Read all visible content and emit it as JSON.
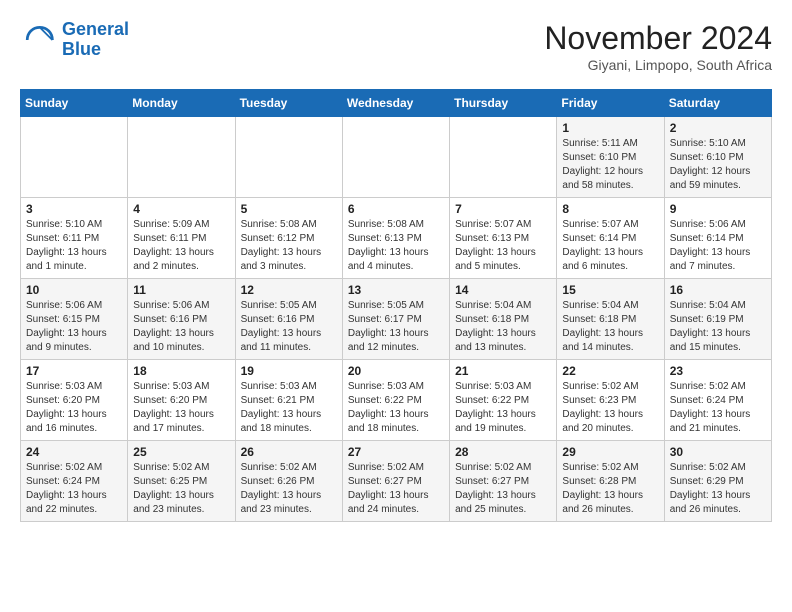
{
  "header": {
    "logo_line1": "General",
    "logo_line2": "Blue",
    "month": "November 2024",
    "location": "Giyani, Limpopo, South Africa"
  },
  "days_of_week": [
    "Sunday",
    "Monday",
    "Tuesday",
    "Wednesday",
    "Thursday",
    "Friday",
    "Saturday"
  ],
  "weeks": [
    [
      {
        "day": "",
        "info": ""
      },
      {
        "day": "",
        "info": ""
      },
      {
        "day": "",
        "info": ""
      },
      {
        "day": "",
        "info": ""
      },
      {
        "day": "",
        "info": ""
      },
      {
        "day": "1",
        "info": "Sunrise: 5:11 AM\nSunset: 6:10 PM\nDaylight: 12 hours and 58 minutes."
      },
      {
        "day": "2",
        "info": "Sunrise: 5:10 AM\nSunset: 6:10 PM\nDaylight: 12 hours and 59 minutes."
      }
    ],
    [
      {
        "day": "3",
        "info": "Sunrise: 5:10 AM\nSunset: 6:11 PM\nDaylight: 13 hours and 1 minute."
      },
      {
        "day": "4",
        "info": "Sunrise: 5:09 AM\nSunset: 6:11 PM\nDaylight: 13 hours and 2 minutes."
      },
      {
        "day": "5",
        "info": "Sunrise: 5:08 AM\nSunset: 6:12 PM\nDaylight: 13 hours and 3 minutes."
      },
      {
        "day": "6",
        "info": "Sunrise: 5:08 AM\nSunset: 6:13 PM\nDaylight: 13 hours and 4 minutes."
      },
      {
        "day": "7",
        "info": "Sunrise: 5:07 AM\nSunset: 6:13 PM\nDaylight: 13 hours and 5 minutes."
      },
      {
        "day": "8",
        "info": "Sunrise: 5:07 AM\nSunset: 6:14 PM\nDaylight: 13 hours and 6 minutes."
      },
      {
        "day": "9",
        "info": "Sunrise: 5:06 AM\nSunset: 6:14 PM\nDaylight: 13 hours and 7 minutes."
      }
    ],
    [
      {
        "day": "10",
        "info": "Sunrise: 5:06 AM\nSunset: 6:15 PM\nDaylight: 13 hours and 9 minutes."
      },
      {
        "day": "11",
        "info": "Sunrise: 5:06 AM\nSunset: 6:16 PM\nDaylight: 13 hours and 10 minutes."
      },
      {
        "day": "12",
        "info": "Sunrise: 5:05 AM\nSunset: 6:16 PM\nDaylight: 13 hours and 11 minutes."
      },
      {
        "day": "13",
        "info": "Sunrise: 5:05 AM\nSunset: 6:17 PM\nDaylight: 13 hours and 12 minutes."
      },
      {
        "day": "14",
        "info": "Sunrise: 5:04 AM\nSunset: 6:18 PM\nDaylight: 13 hours and 13 minutes."
      },
      {
        "day": "15",
        "info": "Sunrise: 5:04 AM\nSunset: 6:18 PM\nDaylight: 13 hours and 14 minutes."
      },
      {
        "day": "16",
        "info": "Sunrise: 5:04 AM\nSunset: 6:19 PM\nDaylight: 13 hours and 15 minutes."
      }
    ],
    [
      {
        "day": "17",
        "info": "Sunrise: 5:03 AM\nSunset: 6:20 PM\nDaylight: 13 hours and 16 minutes."
      },
      {
        "day": "18",
        "info": "Sunrise: 5:03 AM\nSunset: 6:20 PM\nDaylight: 13 hours and 17 minutes."
      },
      {
        "day": "19",
        "info": "Sunrise: 5:03 AM\nSunset: 6:21 PM\nDaylight: 13 hours and 18 minutes."
      },
      {
        "day": "20",
        "info": "Sunrise: 5:03 AM\nSunset: 6:22 PM\nDaylight: 13 hours and 18 minutes."
      },
      {
        "day": "21",
        "info": "Sunrise: 5:03 AM\nSunset: 6:22 PM\nDaylight: 13 hours and 19 minutes."
      },
      {
        "day": "22",
        "info": "Sunrise: 5:02 AM\nSunset: 6:23 PM\nDaylight: 13 hours and 20 minutes."
      },
      {
        "day": "23",
        "info": "Sunrise: 5:02 AM\nSunset: 6:24 PM\nDaylight: 13 hours and 21 minutes."
      }
    ],
    [
      {
        "day": "24",
        "info": "Sunrise: 5:02 AM\nSunset: 6:24 PM\nDaylight: 13 hours and 22 minutes."
      },
      {
        "day": "25",
        "info": "Sunrise: 5:02 AM\nSunset: 6:25 PM\nDaylight: 13 hours and 23 minutes."
      },
      {
        "day": "26",
        "info": "Sunrise: 5:02 AM\nSunset: 6:26 PM\nDaylight: 13 hours and 23 minutes."
      },
      {
        "day": "27",
        "info": "Sunrise: 5:02 AM\nSunset: 6:27 PM\nDaylight: 13 hours and 24 minutes."
      },
      {
        "day": "28",
        "info": "Sunrise: 5:02 AM\nSunset: 6:27 PM\nDaylight: 13 hours and 25 minutes."
      },
      {
        "day": "29",
        "info": "Sunrise: 5:02 AM\nSunset: 6:28 PM\nDaylight: 13 hours and 26 minutes."
      },
      {
        "day": "30",
        "info": "Sunrise: 5:02 AM\nSunset: 6:29 PM\nDaylight: 13 hours and 26 minutes."
      }
    ]
  ]
}
